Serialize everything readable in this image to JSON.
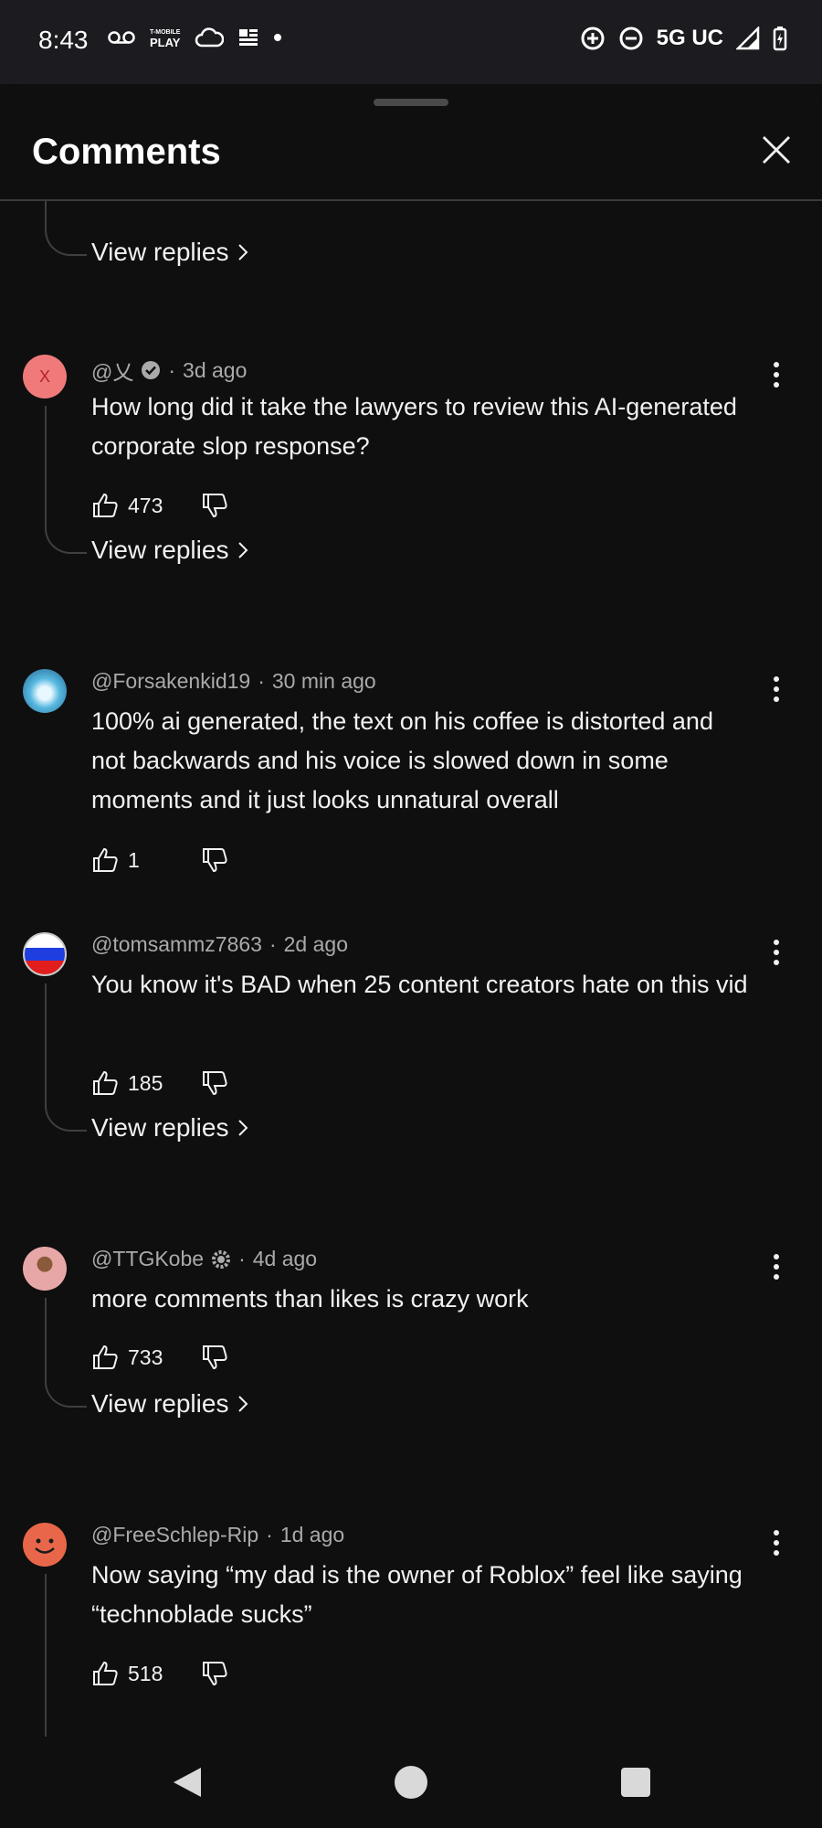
{
  "status_bar": {
    "time": "8:43",
    "carrier_icon_text_top": "T-MOBILE",
    "carrier_icon_text_bottom": "PLAY",
    "network": "5G UC"
  },
  "sheet": {
    "title": "Comments"
  },
  "view_replies_label": "View replies",
  "comments": [
    {
      "avatar_letter": "X",
      "avatar_color": "#f07a7a",
      "handle": "@乂",
      "verified": true,
      "time": "3d ago",
      "text": "How long did it take the lawyers to review this AI-generated corporate slop response?",
      "likes": "473"
    },
    {
      "avatar_color": "#58b8e0",
      "handle": "@Forsakenkid19",
      "time": "30 min ago",
      "text": "100% ai generated, the text on his coffee is distorted and not backwards and his voice is slowed down in some moments and it just looks unnatural overall",
      "likes": "1"
    },
    {
      "avatar_color": "#ffffff",
      "handle": "@tomsammz7863",
      "time": "2d ago",
      "text": "You know it's BAD when 25 content creators hate on this vid",
      "likes": "185"
    },
    {
      "avatar_color": "#e8a7a7",
      "handle": "@TTGKobe",
      "time": "4d ago",
      "text": "more comments than likes is crazy work",
      "likes": "733"
    },
    {
      "avatar_color": "#e8674a",
      "handle": "@FreeSchlep-Rip",
      "time": "1d ago",
      "text": "Now saying “my dad is the owner of Roblox” feel like saying “technoblade sucks”",
      "likes": "518"
    }
  ],
  "colors": {
    "background": "#0f0f0f",
    "text_primary": "#f1f1f1",
    "text_secondary": "#aaaaaa",
    "thread_line": "#3f3f3f"
  }
}
